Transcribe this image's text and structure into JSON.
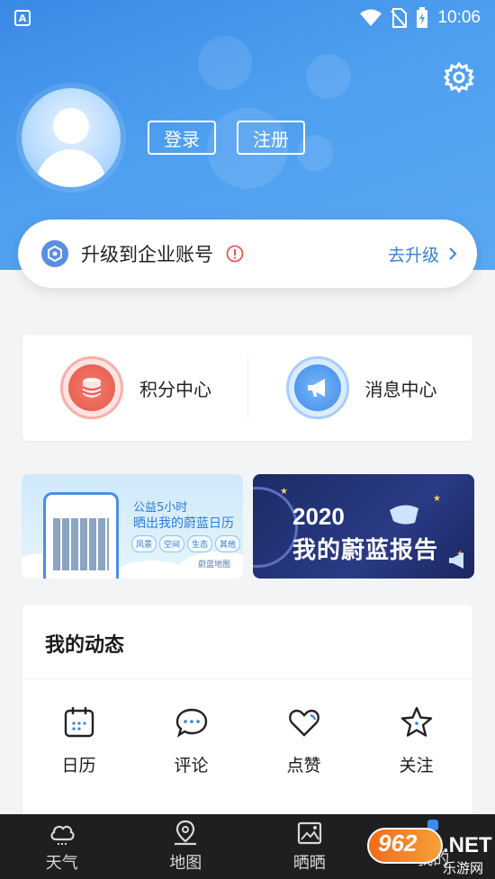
{
  "status_bar": {
    "time": "10:06",
    "app_badge": "A"
  },
  "profile": {
    "login_label": "登录",
    "register_label": "注册"
  },
  "upgrade": {
    "text": "升级到企业账号",
    "action_label": "去升级"
  },
  "centers": [
    {
      "label": "积分中心",
      "icon": "coin-stack-icon"
    },
    {
      "label": "消息中心",
      "icon": "megaphone-icon"
    }
  ],
  "banners": {
    "left": {
      "line1": "公益5小时",
      "line2": "晒出我的蔚蓝日历",
      "tags": [
        "风景",
        "空间",
        "生态",
        "其他"
      ],
      "brand": "蔚蓝地图"
    },
    "right": {
      "year": "2020",
      "title": "我的蔚蓝报告"
    }
  },
  "dynamic": {
    "title": "我的动态",
    "items": [
      {
        "label": "日历",
        "icon": "calendar-icon"
      },
      {
        "label": "评论",
        "icon": "comment-icon"
      },
      {
        "label": "点赞",
        "icon": "heart-icon"
      },
      {
        "label": "关注",
        "icon": "star-icon"
      }
    ]
  },
  "tabbar": {
    "items": [
      {
        "label": "天气",
        "icon": "cloud-icon"
      },
      {
        "label": "地图",
        "icon": "map-pin-icon"
      },
      {
        "label": "晒晒",
        "icon": "photo-icon"
      },
      {
        "label": "我的",
        "icon": "profile-icon",
        "active": true
      }
    ]
  },
  "watermark": {
    "number": "962",
    "suffix": ".NET",
    "subtitle": "乐游网"
  },
  "colors": {
    "accent": "#3b7fd9",
    "header_top": "#3a8ae6",
    "tabbar_bg": "#1f1f22",
    "points_red": "#e4584a",
    "message_blue": "#3f8de8"
  }
}
